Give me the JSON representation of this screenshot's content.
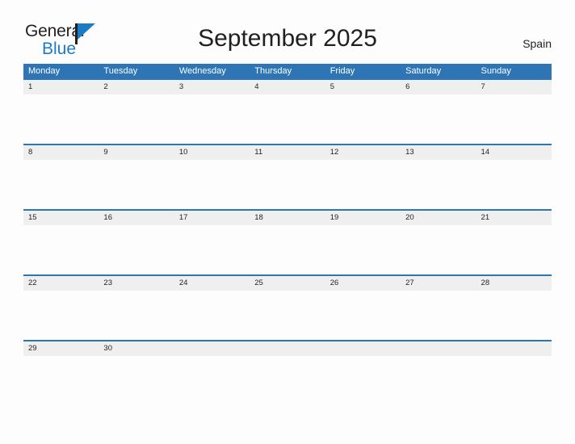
{
  "logo": {
    "word_one": "General",
    "word_two": "Blue",
    "flag_icon": "flag-triangle-icon",
    "primary_color": "#1b7bc4",
    "text_color": "#231f20"
  },
  "header": {
    "title": "September 2025",
    "region": "Spain"
  },
  "theme": {
    "header_blue": "#2e75b6",
    "date_band_gray": "#efefef",
    "page_background": "#fdfdfd",
    "text_color": "#231f20",
    "header_text_color": "#ffffff"
  },
  "calendar": {
    "month": "September",
    "year": "2025",
    "week_start": "Monday",
    "weekdays": [
      "Monday",
      "Tuesday",
      "Wednesday",
      "Thursday",
      "Friday",
      "Saturday",
      "Sunday"
    ],
    "weeks": [
      {
        "days": [
          "1",
          "2",
          "3",
          "4",
          "5",
          "6",
          "7"
        ]
      },
      {
        "days": [
          "8",
          "9",
          "10",
          "11",
          "12",
          "13",
          "14"
        ]
      },
      {
        "days": [
          "15",
          "16",
          "17",
          "18",
          "19",
          "20",
          "21"
        ]
      },
      {
        "days": [
          "22",
          "23",
          "24",
          "25",
          "26",
          "27",
          "28"
        ]
      },
      {
        "days": [
          "29",
          "30",
          "",
          "",
          "",
          "",
          ""
        ]
      }
    ]
  }
}
